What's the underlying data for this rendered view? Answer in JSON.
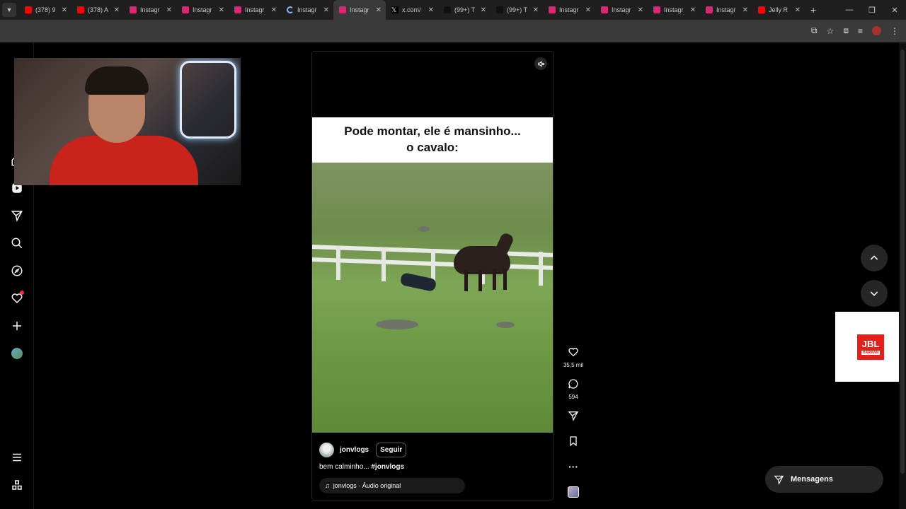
{
  "browser": {
    "tabs": [
      {
        "title": "(378) 9",
        "favicon": "youtube-icon",
        "active": false
      },
      {
        "title": "(378) A",
        "favicon": "youtube-icon",
        "active": false
      },
      {
        "title": "Instagr",
        "favicon": "instagram-icon",
        "active": false
      },
      {
        "title": "Instagr",
        "favicon": "instagram-icon",
        "active": false
      },
      {
        "title": "Instagr",
        "favicon": "instagram-icon",
        "active": false
      },
      {
        "title": "Instagr",
        "favicon": "loading-icon",
        "active": false
      },
      {
        "title": "Instagr",
        "favicon": "instagram-icon",
        "active": true
      },
      {
        "title": "x.com/",
        "favicon": "x-icon",
        "active": false
      },
      {
        "title": "(99+) T",
        "favicon": "tiktok-icon",
        "active": false
      },
      {
        "title": "(99+) T",
        "favicon": "tiktok-icon",
        "active": false
      },
      {
        "title": "Instagr",
        "favicon": "instagram-icon",
        "active": false
      },
      {
        "title": "Instagr",
        "favicon": "instagram-icon",
        "active": false
      },
      {
        "title": "Instagr",
        "favicon": "instagram-icon",
        "active": false
      },
      {
        "title": "Instagr",
        "favicon": "instagram-icon",
        "active": false
      },
      {
        "title": "Jelly R",
        "favicon": "youtube-icon",
        "active": false
      }
    ]
  },
  "reel": {
    "video_caption_line1": "Pode montar, ele é mansinho...",
    "video_caption_line2": "o cavalo:",
    "author": "jonvlogs",
    "follow_label": "Seguir",
    "caption_text": "bem calminho...",
    "caption_hashtag": "#jonvlogs",
    "audio": "jonvlogs · Áudio original"
  },
  "actions": {
    "likes": "35,5 mil",
    "comments": "594"
  },
  "messages": {
    "label": "Mensagens"
  },
  "ad": {
    "brand": "JBL",
    "sub": "HARMAN"
  },
  "colors": {
    "background": "#000000",
    "notification": "#ff3040",
    "jbl_red": "#e3211c"
  }
}
